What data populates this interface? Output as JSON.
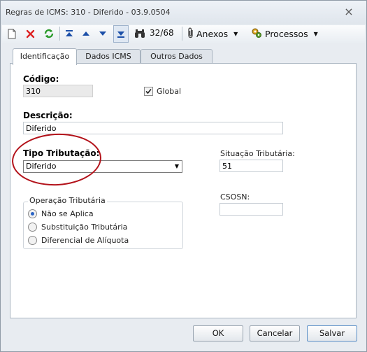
{
  "window": {
    "title": "Regras de ICMS: 310 - Diferido - 03.9.0504",
    "close_glyph": "×"
  },
  "toolbar": {
    "record_position": "32/68",
    "anexos_label": "Anexos",
    "processos_label": "Processos",
    "icons": [
      "new-document-icon",
      "delete-icon",
      "refresh-icon",
      "first-record-icon",
      "previous-record-icon",
      "next-record-icon",
      "last-record-icon",
      "binoculars-icon",
      "paperclip-icon",
      "processes-icon"
    ]
  },
  "tabs": [
    {
      "label": "Identificação",
      "active": true
    },
    {
      "label": "Dados ICMS",
      "active": false
    },
    {
      "label": "Outros Dados",
      "active": false
    }
  ],
  "form": {
    "codigo_label": "Código:",
    "codigo_value": "310",
    "global_label": "Global",
    "global_checked": true,
    "descricao_label": "Descrição:",
    "descricao_value": "Diferido",
    "tipo_tributacao_label": "Tipo Tributação:",
    "tipo_tributacao_value": "Diferido",
    "situacao_label": "Situação Tributária:",
    "situacao_value": "51",
    "csosn_label": "CSOSN:",
    "csosn_value": "",
    "operacao_group_label": "Operação Tributária",
    "operacao_options": [
      {
        "label": "Não se Aplica",
        "checked": true
      },
      {
        "label": "Substituição Tributária",
        "checked": false
      },
      {
        "label": "Diferencial de Alíquota",
        "checked": false
      }
    ]
  },
  "buttons": {
    "ok": "OK",
    "cancel": "Cancelar",
    "save": "Salvar"
  },
  "colors": {
    "highlight_ellipse": "#b3121a",
    "window_bg": "#e8ecf1",
    "accent": "#2a64c5"
  }
}
